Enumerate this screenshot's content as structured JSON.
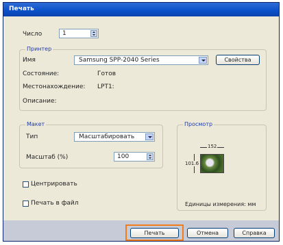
{
  "window": {
    "title": "Печать"
  },
  "copies": {
    "label": "Число",
    "value": "1"
  },
  "printer": {
    "group_title": "Принтер",
    "name_label": "Имя",
    "name_value": "Samsung SPP-2040 Series",
    "properties_button": "Свойства",
    "status_label": "Состояние:",
    "status_value": "Готов",
    "location_label": "Местонахождение:",
    "location_value": "LPT1:",
    "comment_label": "Описание:"
  },
  "layout": {
    "group_title": "Макет",
    "type_label": "Тип",
    "type_value": "Масштабировать",
    "scale_label": "Масштаб (%)",
    "scale_value": "100"
  },
  "preview": {
    "group_title": "Просмотр",
    "width_dim": "152",
    "height_dim": "101.6",
    "units_label": "Единицы измерения: мм"
  },
  "options": {
    "center_label": "Центрировать",
    "print_to_file_label": "Печать в файл"
  },
  "buttons": {
    "print": "Печать",
    "cancel": "Отмена",
    "help": "Справка"
  },
  "colors": {
    "title_bar": "#0a50c8",
    "dialog_bg": "#ece9d8",
    "highlight": "#f07d1a",
    "group_caption": "#1f3aa8"
  }
}
